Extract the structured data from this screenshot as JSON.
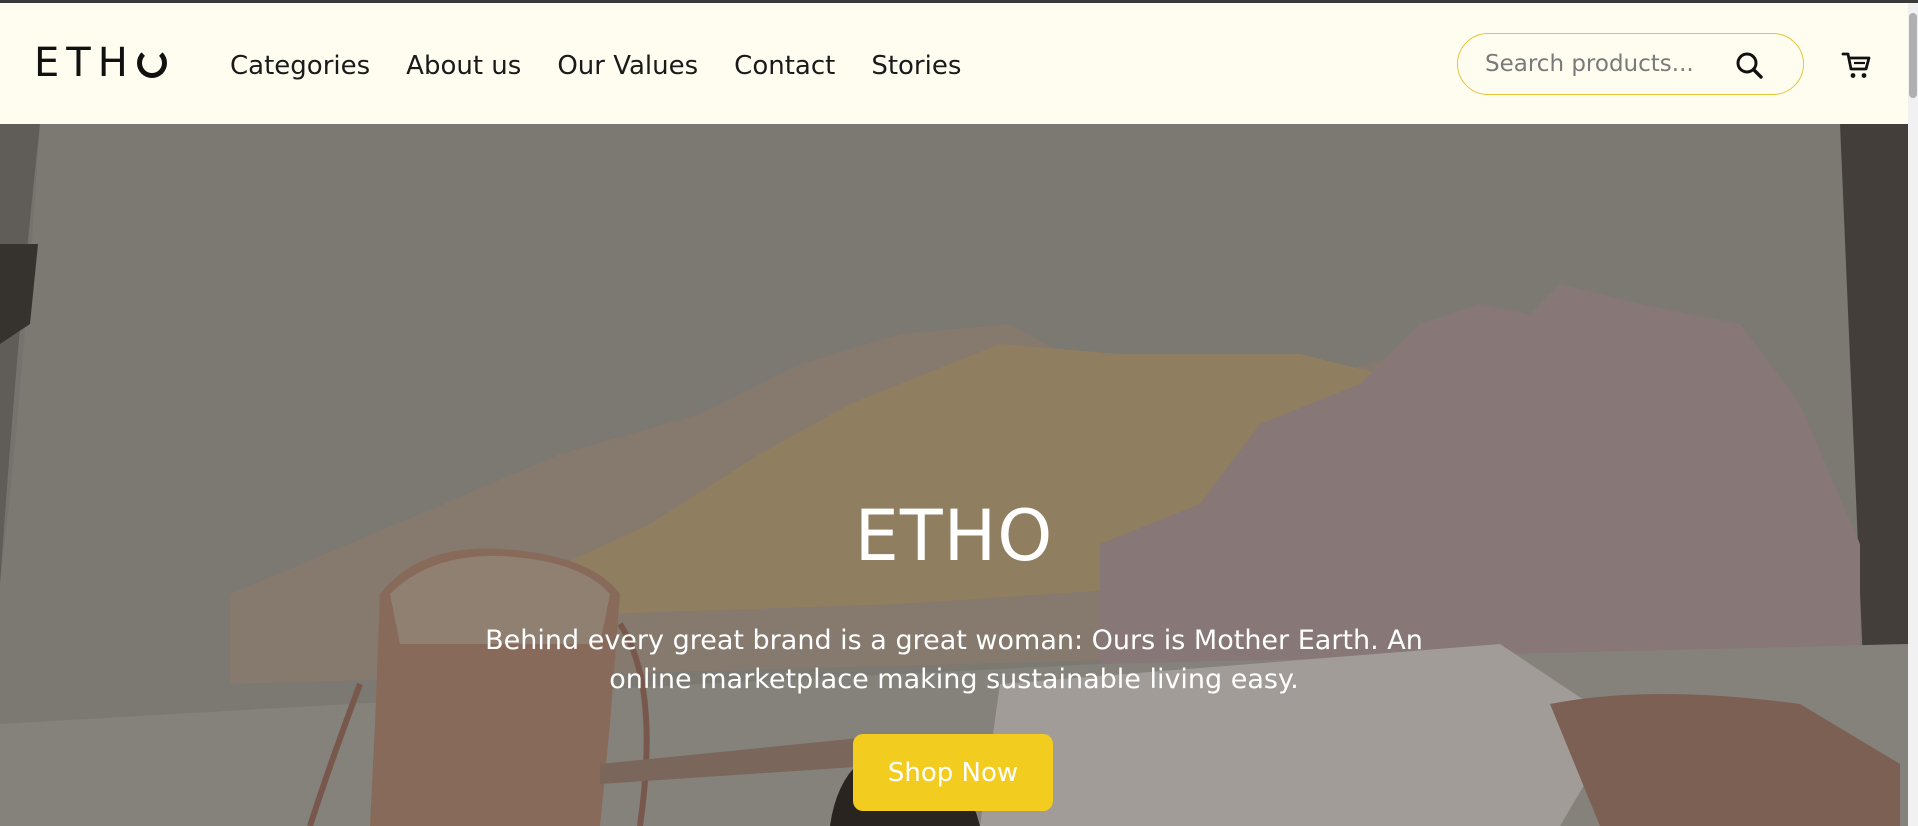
{
  "brand": {
    "logo_text": "ETH",
    "logo_icon": "o-arc-icon"
  },
  "nav": {
    "items": [
      {
        "label": "Categories"
      },
      {
        "label": "About us"
      },
      {
        "label": "Our Values"
      },
      {
        "label": "Contact"
      },
      {
        "label": "Stories"
      }
    ]
  },
  "search": {
    "placeholder": "Search products...",
    "value": "",
    "icon": "search-icon"
  },
  "cart": {
    "icon": "cart-icon"
  },
  "hero": {
    "title": "ETHO",
    "subtitle": "Behind every great brand is a great woman: Ours is Mother Earth. An online marketplace making sustainable living easy.",
    "cta_label": "Shop Now",
    "image": "hero-photo"
  },
  "colors": {
    "header_bg": "#fffdf0",
    "accent": "#f2cc1f",
    "search_border": "#e8c33a",
    "text_dark": "#1a1a1a"
  }
}
